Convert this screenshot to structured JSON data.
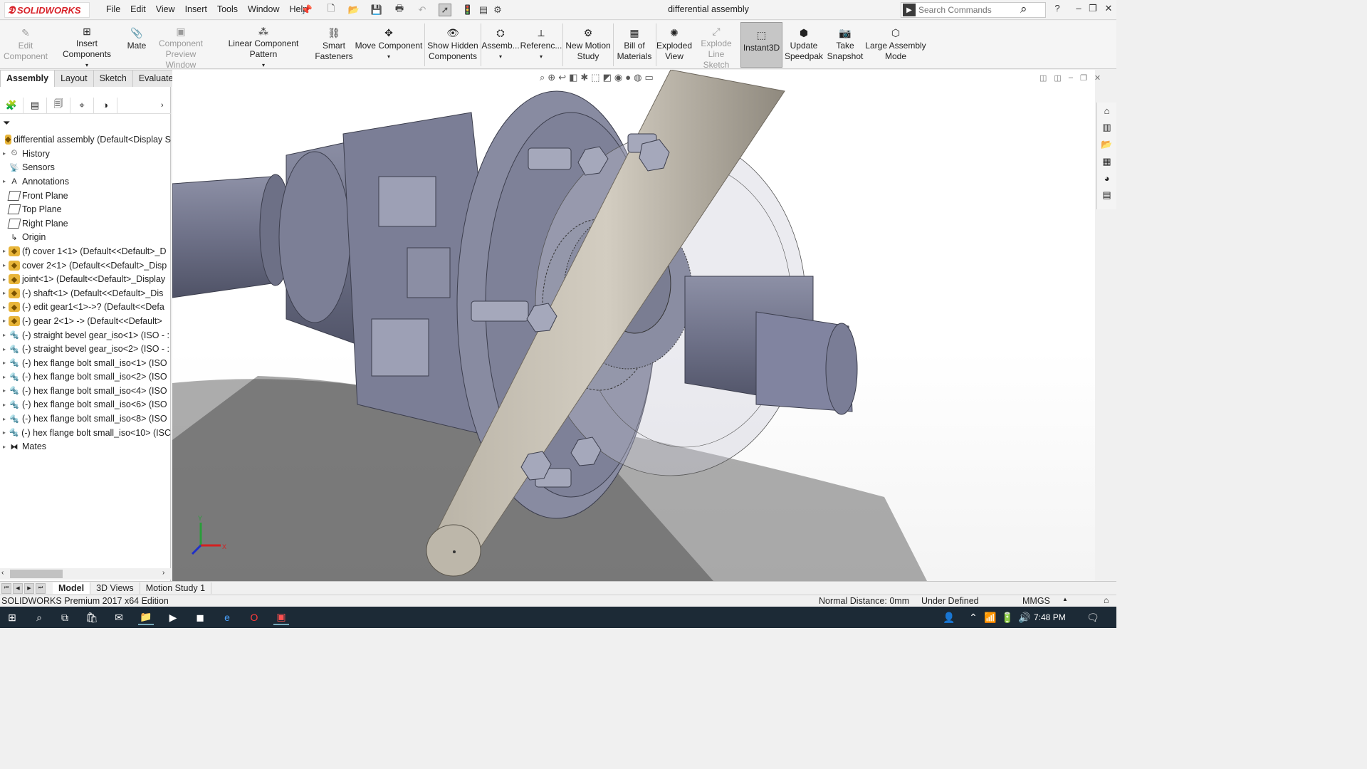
{
  "app": {
    "logo_text": "SOLIDWORKS",
    "document_title": "differential assembly"
  },
  "menu": [
    "File",
    "Edit",
    "View",
    "Insert",
    "Tools",
    "Window",
    "Help"
  ],
  "search": {
    "placeholder": "Search Commands"
  },
  "commands": [
    {
      "label": "Edit Component",
      "icon": "edit-component-icon",
      "enabled": false
    },
    {
      "label": "Insert Components",
      "icon": "insert-components-icon",
      "enabled": true
    },
    {
      "label": "Mate",
      "icon": "mate-icon",
      "enabled": true
    },
    {
      "label": "Component Preview Window",
      "icon": "preview-window-icon",
      "enabled": false
    },
    {
      "label": "Linear Component Pattern",
      "icon": "linear-pattern-icon",
      "enabled": true
    },
    {
      "label": "Smart Fasteners",
      "icon": "smart-fasteners-icon",
      "enabled": true
    },
    {
      "label": "Move Component",
      "icon": "move-component-icon",
      "enabled": true
    },
    {
      "label": "Show Hidden Components",
      "icon": "show-hidden-icon",
      "enabled": true
    },
    {
      "label": "Assemb...",
      "icon": "assembly-features-icon",
      "enabled": true
    },
    {
      "label": "Referenc...",
      "icon": "reference-geometry-icon",
      "enabled": true
    },
    {
      "label": "New Motion Study",
      "icon": "motion-study-icon",
      "enabled": true
    },
    {
      "label": "Bill of Materials",
      "icon": "bom-icon",
      "enabled": true
    },
    {
      "label": "Exploded View",
      "icon": "exploded-view-icon",
      "enabled": true
    },
    {
      "label": "Explode Line Sketch",
      "icon": "explode-line-icon",
      "enabled": false
    },
    {
      "label": "Instant3D",
      "icon": "instant3d-icon",
      "enabled": true,
      "active": true
    },
    {
      "label": "Update Speedpak",
      "icon": "speedpak-icon",
      "enabled": true
    },
    {
      "label": "Take Snapshot",
      "icon": "snapshot-icon",
      "enabled": true
    },
    {
      "label": "Large Assembly Mode",
      "icon": "large-assembly-icon",
      "enabled": true
    }
  ],
  "cm_tabs": [
    "Assembly",
    "Layout",
    "Sketch",
    "Evaluate"
  ],
  "tree": {
    "root": "differential assembly  (Default<Display S",
    "items": [
      {
        "label": "History",
        "icon": "history-icon",
        "expandable": true
      },
      {
        "label": "Sensors",
        "icon": "sensors-icon",
        "expandable": false
      },
      {
        "label": "Annotations",
        "icon": "annotations-icon",
        "expandable": true
      },
      {
        "label": "Front Plane",
        "icon": "plane-icon",
        "expandable": false
      },
      {
        "label": "Top Plane",
        "icon": "plane-icon",
        "expandable": false
      },
      {
        "label": "Right Plane",
        "icon": "plane-icon",
        "expandable": false
      },
      {
        "label": "Origin",
        "icon": "origin-icon",
        "expandable": false
      },
      {
        "label": "(f) cover 1<1> (Default<<Default>_D",
        "icon": "assembly-part-icon",
        "expandable": true
      },
      {
        "label": "cover 2<1> (Default<<Default>_Disp",
        "icon": "assembly-part-icon",
        "expandable": true
      },
      {
        "label": "joint<1> (Default<<Default>_Display",
        "icon": "assembly-part-icon",
        "expandable": true
      },
      {
        "label": "(-) shaft<1> (Default<<Default>_Dis",
        "icon": "assembly-part-icon",
        "expandable": true
      },
      {
        "label": "(-) edit gear1<1>->? (Default<<Defa",
        "icon": "assembly-part-icon",
        "expandable": true
      },
      {
        "label": "(-) gear 2<1> -> (Default<<Default>",
        "icon": "assembly-part-icon",
        "expandable": true
      },
      {
        "label": "(-) straight bevel gear_iso<1> (ISO - :",
        "icon": "toolbox-part-icon",
        "expandable": true
      },
      {
        "label": "(-) straight bevel gear_iso<2> (ISO - :",
        "icon": "toolbox-part-icon",
        "expandable": true
      },
      {
        "label": "(-) hex flange bolt small_iso<1> (ISO",
        "icon": "toolbox-part-icon",
        "expandable": true
      },
      {
        "label": "(-) hex flange bolt small_iso<2> (ISO",
        "icon": "toolbox-part-icon",
        "expandable": true
      },
      {
        "label": "(-) hex flange bolt small_iso<4> (ISO",
        "icon": "toolbox-part-icon",
        "expandable": true
      },
      {
        "label": "(-) hex flange bolt small_iso<6> (ISO",
        "icon": "toolbox-part-icon",
        "expandable": true
      },
      {
        "label": "(-) hex flange bolt small_iso<8> (ISO",
        "icon": "toolbox-part-icon",
        "expandable": true
      },
      {
        "label": "(-) hex flange bolt small_iso<10> (ISC",
        "icon": "toolbox-part-icon",
        "expandable": true
      },
      {
        "label": "Mates",
        "icon": "mates-icon",
        "expandable": true
      }
    ]
  },
  "bottom_tabs": [
    "Model",
    "3D Views",
    "Motion Study 1"
  ],
  "status": {
    "edition": "SOLIDWORKS Premium 2017 x64 Edition",
    "normal_distance": "Normal Distance: 0mm",
    "state": "Under Defined",
    "units": "MMGS"
  },
  "triad": {
    "x": "X",
    "y": "Y"
  },
  "taskbar": {
    "time": "7:48 PM"
  }
}
